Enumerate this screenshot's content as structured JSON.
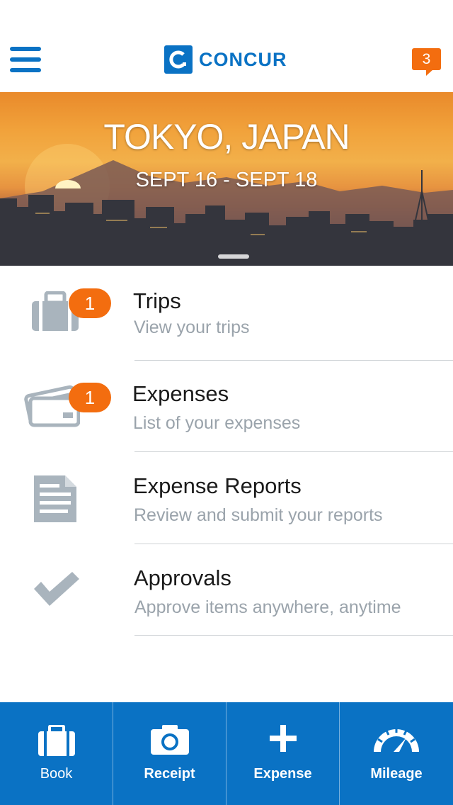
{
  "header": {
    "brand": "CONCUR",
    "notification_count": "3"
  },
  "hero": {
    "city": "TOKYO, JAPAN",
    "dates": "SEPT 16 - SEPT 18"
  },
  "menu": {
    "items": [
      {
        "title": "Trips",
        "subtitle": "View your trips",
        "badge": "1",
        "icon": "suitcase-icon"
      },
      {
        "title": "Expenses",
        "subtitle": "List of your expenses",
        "badge": "1",
        "icon": "credit-card-icon"
      },
      {
        "title": "Expense Reports",
        "subtitle": "Review and submit your reports",
        "icon": "document-icon"
      },
      {
        "title": "Approvals",
        "subtitle": "Approve items anywhere, anytime",
        "icon": "checkmark-icon"
      }
    ]
  },
  "tabbar": {
    "tabs": [
      {
        "label": "Book",
        "icon": "briefcase-icon"
      },
      {
        "label": "Receipt",
        "icon": "camera-icon"
      },
      {
        "label": "Expense",
        "icon": "plus-icon"
      },
      {
        "label": "Mileage",
        "icon": "speedometer-icon"
      }
    ]
  },
  "colors": {
    "brand_blue": "#0a72c4",
    "badge_orange": "#f36d0f",
    "icon_gray": "#a9b4bd",
    "subtitle_gray": "#9aa3ab"
  }
}
